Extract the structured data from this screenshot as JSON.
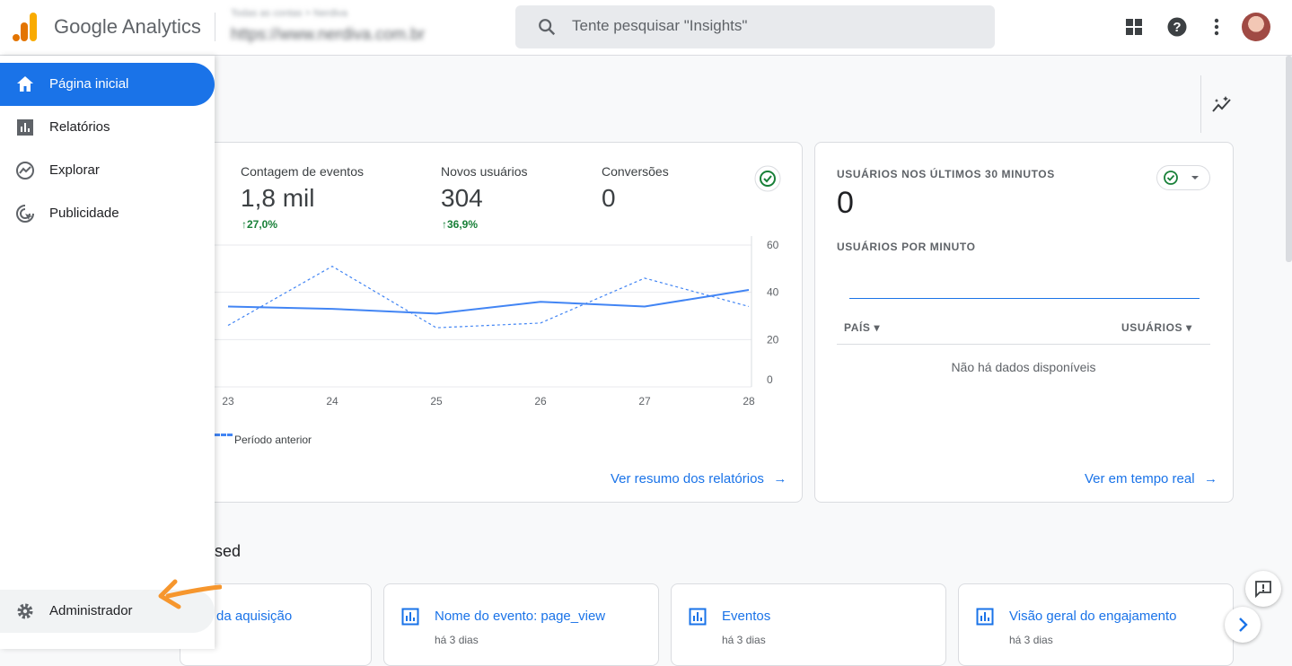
{
  "header": {
    "brand": "Google Analytics",
    "account_path": "Todas as contas > Nerdiva",
    "property_url": "https://www.nerdiva.com.br",
    "search_placeholder": "Tente pesquisar \"Insights\""
  },
  "sidebar": {
    "items": [
      {
        "label": "Página inicial",
        "icon": "home-icon",
        "active": true
      },
      {
        "label": "Relatórios",
        "icon": "bar-chart-icon"
      },
      {
        "label": "Explorar",
        "icon": "explore-icon"
      },
      {
        "label": "Publicidade",
        "icon": "advertising-icon"
      }
    ],
    "admin_label": "Administrador"
  },
  "overview": {
    "metrics": [
      {
        "label": "Contagem de eventos",
        "value": "1,8 mil",
        "change": "27,0%"
      },
      {
        "label": "Novos usuários",
        "value": "304",
        "change": "36,9%"
      },
      {
        "label": "Conversões",
        "value": "0",
        "change": ""
      }
    ],
    "legend_previous": "Período anterior",
    "link": "Ver resumo dos relatórios"
  },
  "chart_data": {
    "type": "line",
    "x": [
      "23",
      "24",
      "25",
      "26",
      "27",
      "28"
    ],
    "y_ticks": [
      "0",
      "20",
      "40",
      "60"
    ],
    "ylim": [
      0,
      60
    ],
    "series": [
      {
        "style": "solid",
        "color": "#4285f4",
        "values": [
          34,
          33,
          31,
          36,
          34,
          41
        ]
      },
      {
        "name": "Período anterior",
        "style": "dashed",
        "color": "#4285f4",
        "values": [
          26,
          51,
          25,
          27,
          46,
          34
        ]
      }
    ]
  },
  "realtime": {
    "title": "USUÁRIOS NOS ÚLTIMOS 30 MINUTOS",
    "value": "0",
    "per_minute_label": "USUÁRIOS POR MINUTO",
    "col_country": "PAÍS",
    "col_users": "USUÁRIOS",
    "no_data": "Não há dados disponíveis",
    "link": "Ver em tempo real"
  },
  "recent": {
    "heading_fragment": "sed",
    "cards": [
      {
        "title": "da aquisição",
        "meta": ""
      },
      {
        "title": "Nome do evento: page_view",
        "meta": "há 3 dias"
      },
      {
        "title": "Eventos",
        "meta": "há 3 dias"
      },
      {
        "title": "Visão geral do engajamento",
        "meta": "há 3 dias"
      }
    ]
  },
  "colors": {
    "accent": "#1a73e8",
    "positive": "#188038",
    "arrow": "#f6962d"
  }
}
